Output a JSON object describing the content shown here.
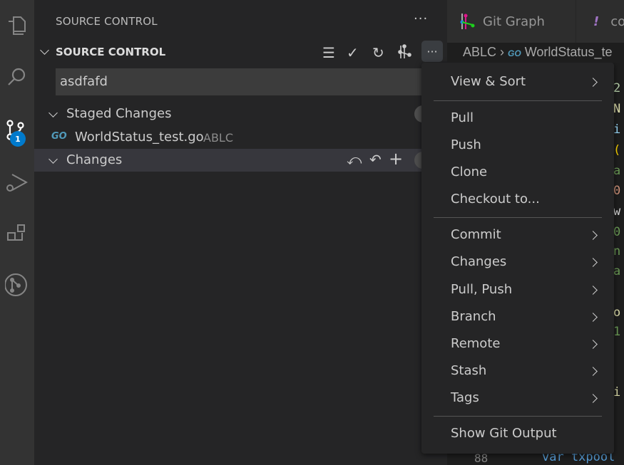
{
  "sidebar": {
    "title": "SOURCE CONTROL",
    "section": "SOURCE CONTROL",
    "commit_message": "asdfafd",
    "scm_badge": "1",
    "staged": {
      "label": "Staged Changes",
      "file": "WorldStatus_test.go",
      "folder": "ABLC",
      "file_icon": "GO"
    },
    "changes": {
      "label": "Changes"
    }
  },
  "tabs": [
    {
      "label": "Git Graph"
    },
    {
      "label": "co",
      "icon": "!"
    }
  ],
  "breadcrumb": {
    "folder": "ABLC",
    "file": "WorldStatus_te",
    "file_icon": "GO"
  },
  "editor": {
    "line_number": "88",
    "code_fragments": [
      "2",
      "N",
      "i",
      "(",
      "a",
      "0",
      "w",
      "0",
      "n",
      "a",
      "o",
      "1",
      "i"
    ],
    "last_line": "var txpool"
  },
  "menu": {
    "items": [
      {
        "label": "View & Sort",
        "submenu": true
      },
      {
        "label": "Pull"
      },
      {
        "label": "Push"
      },
      {
        "label": "Clone"
      },
      {
        "label": "Checkout to..."
      },
      {
        "label": "Commit",
        "submenu": true
      },
      {
        "label": "Changes",
        "submenu": true
      },
      {
        "label": "Pull, Push",
        "submenu": true
      },
      {
        "label": "Branch",
        "submenu": true
      },
      {
        "label": "Remote",
        "submenu": true
      },
      {
        "label": "Stash",
        "submenu": true
      },
      {
        "label": "Tags",
        "submenu": true
      },
      {
        "label": "Show Git Output"
      }
    ]
  }
}
